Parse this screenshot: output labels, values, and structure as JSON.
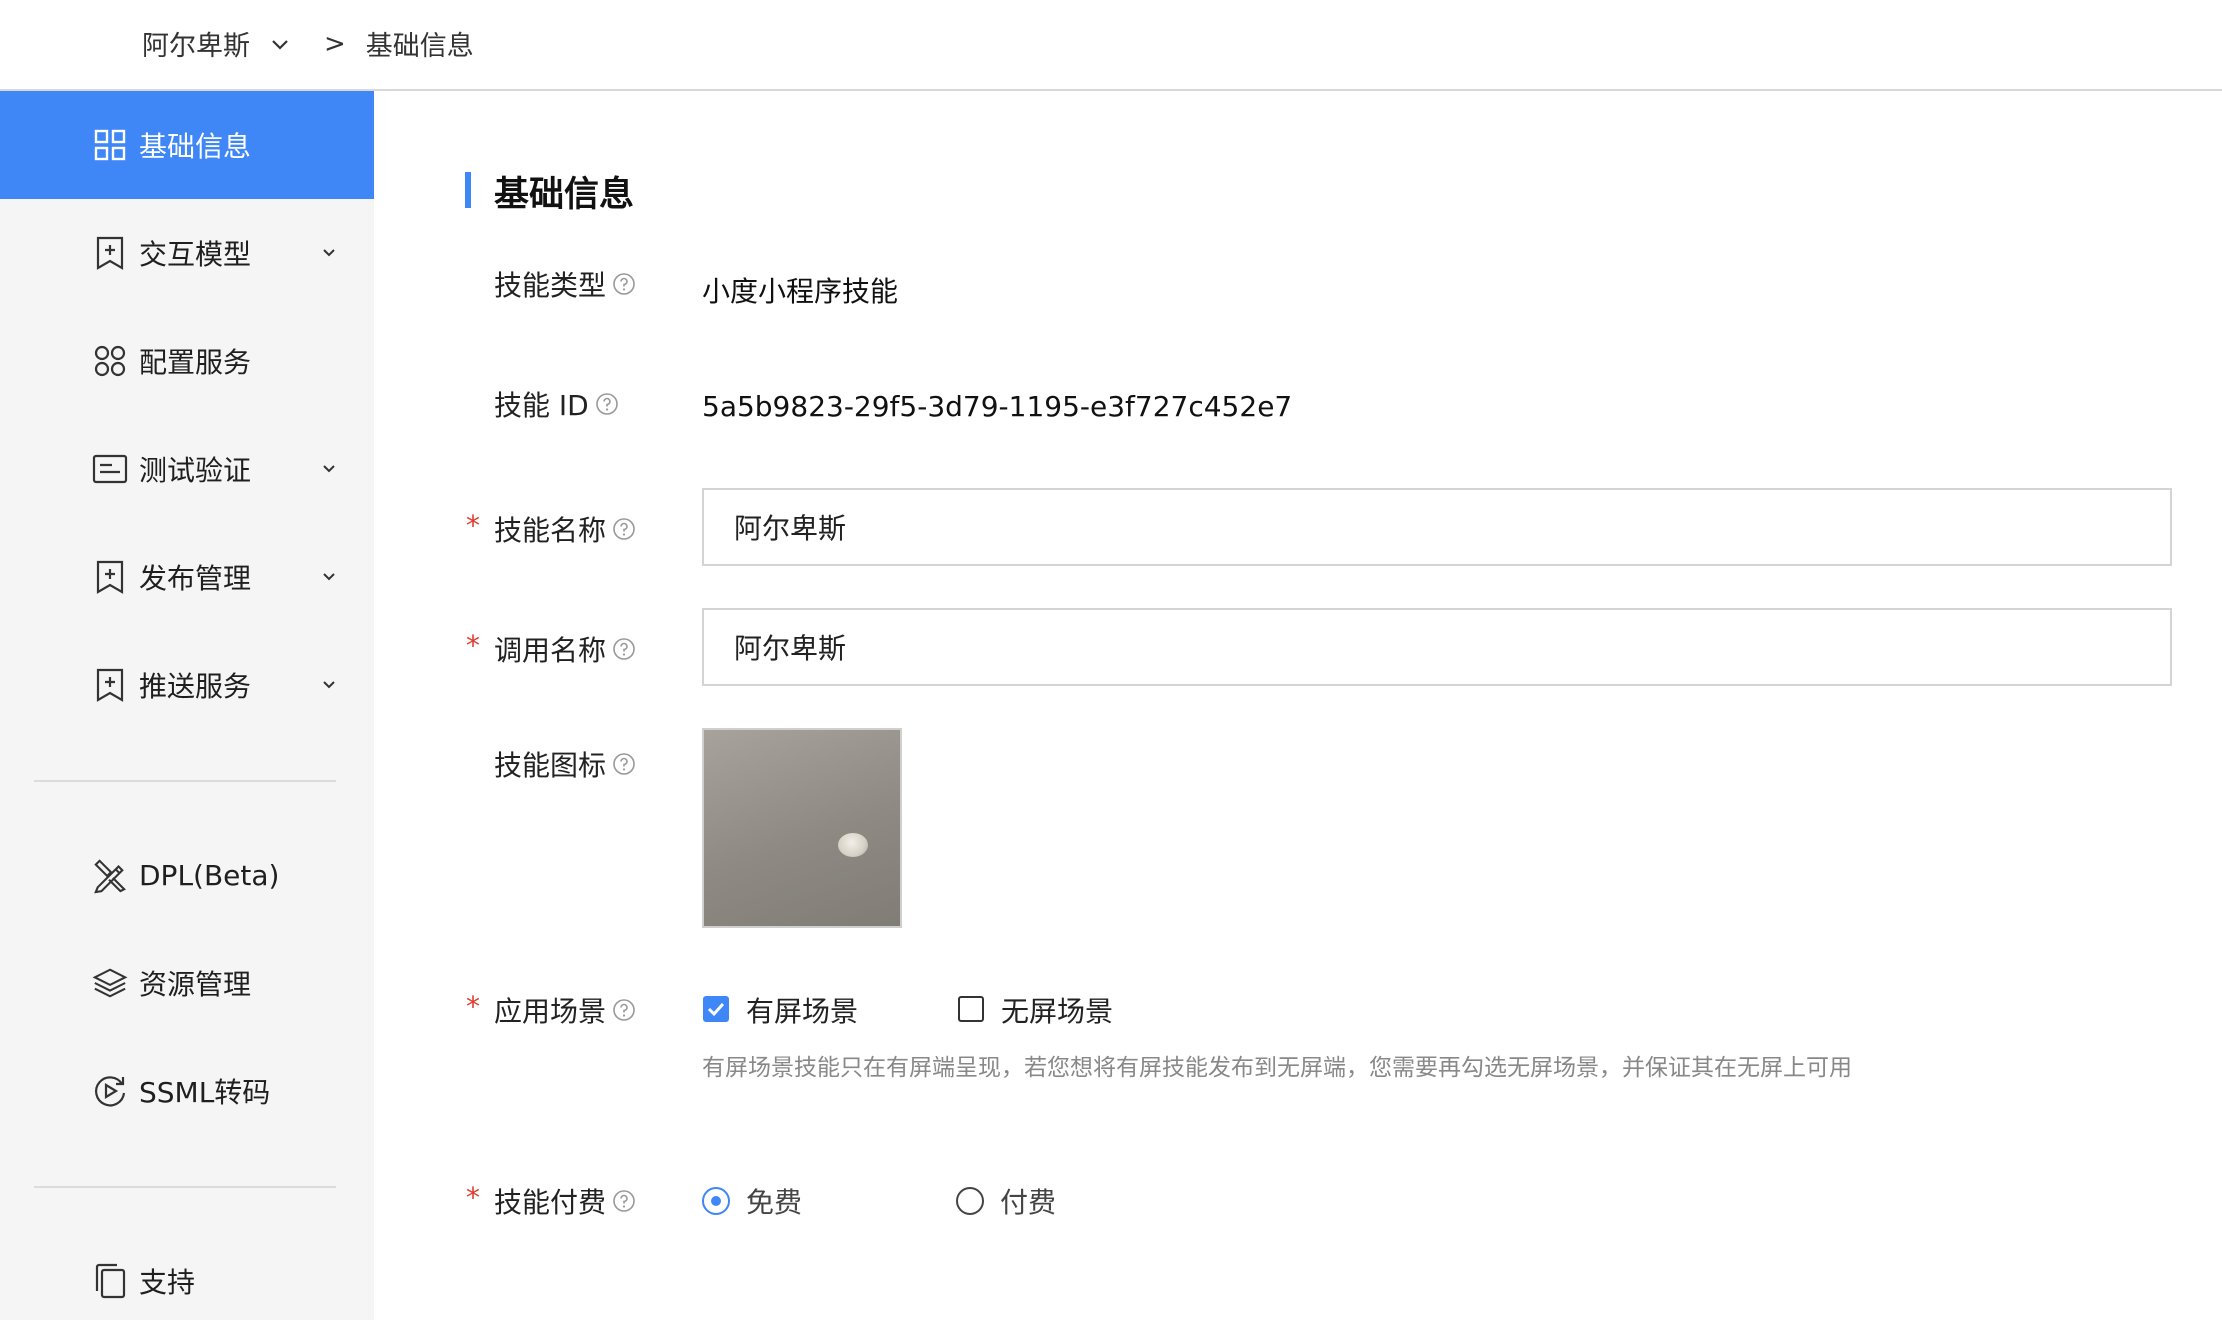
{
  "breadcrumb": {
    "project": "阿尔卑斯",
    "separator": ">",
    "current": "基础信息"
  },
  "sidebar": {
    "items": [
      {
        "label": "基础信息",
        "icon": "grid-icon",
        "active": true,
        "expandable": false
      },
      {
        "label": "交互模型",
        "icon": "bookmark-plus-icon",
        "active": false,
        "expandable": true
      },
      {
        "label": "配置服务",
        "icon": "four-circles-icon",
        "active": false,
        "expandable": false
      },
      {
        "label": "测试验证",
        "icon": "terminal-icon",
        "active": false,
        "expandable": true
      },
      {
        "label": "发布管理",
        "icon": "bookmark-plus-icon",
        "active": false,
        "expandable": true
      },
      {
        "label": "推送服务",
        "icon": "bookmark-plus-icon",
        "active": false,
        "expandable": true
      },
      {
        "label": "DPL(Beta)",
        "icon": "design-tools-icon",
        "active": false,
        "expandable": false
      },
      {
        "label": "资源管理",
        "icon": "layers-icon",
        "active": false,
        "expandable": false
      },
      {
        "label": "SSML转码",
        "icon": "refresh-play-icon",
        "active": false,
        "expandable": false
      },
      {
        "label": "支持",
        "icon": "copy-icon",
        "active": false,
        "expandable": false
      }
    ]
  },
  "main": {
    "section_title": "基础信息",
    "skill_type": {
      "label": "技能类型",
      "value": "小度小程序技能"
    },
    "skill_id": {
      "label": "技能 ID",
      "value": "5a5b9823-29f5-3d79-1195-e3f727c452e7"
    },
    "skill_name": {
      "label": "技能名称",
      "value": "阿尔卑斯",
      "required_mark": "*"
    },
    "invoke_name": {
      "label": "调用名称",
      "value": "阿尔卑斯",
      "required_mark": "*"
    },
    "skill_icon": {
      "label": "技能图标"
    },
    "scene": {
      "label": "应用场景",
      "required_mark": "*",
      "options": [
        {
          "label": "有屏场景",
          "checked": true
        },
        {
          "label": "无屏场景",
          "checked": false
        }
      ],
      "hint": "有屏场景技能只在有屏端呈现，若您想将有屏技能发布到无屏端，您需要再勾选无屏场景，并保证其在无屏上可用"
    },
    "payment": {
      "label": "技能付费",
      "required_mark": "*",
      "options": [
        {
          "label": "免费",
          "selected": true
        },
        {
          "label": "付费",
          "selected": false
        }
      ]
    }
  },
  "colors": {
    "accent": "#3f86f7",
    "required": "#e23b2e",
    "sidebar_bg": "#f5f5f5"
  }
}
